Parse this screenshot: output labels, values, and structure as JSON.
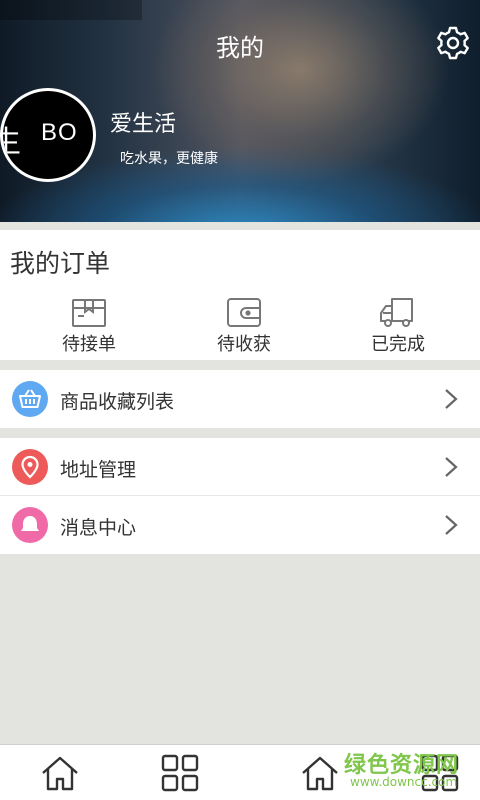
{
  "header": {
    "title": "我的",
    "settings_icon": "gear-icon",
    "user_name": "爱生活",
    "user_slogan": "吃水果，更健康",
    "avatar_text": "BO",
    "avatar_glyph": "生"
  },
  "orders": {
    "title": "我的订单",
    "items": [
      {
        "label": "待接单",
        "icon": "package-icon"
      },
      {
        "label": "待收获",
        "icon": "wallet-icon"
      },
      {
        "label": "已完成",
        "icon": "delivery-truck-icon"
      }
    ]
  },
  "menu": {
    "favorites": {
      "label": "商品收藏列表",
      "icon": "basket-icon",
      "color": "#5fa8f2"
    },
    "address": {
      "label": "地址管理",
      "icon": "location-pin-icon",
      "color": "#ee5a5a"
    },
    "messages": {
      "label": "消息中心",
      "icon": "bell-icon",
      "color": "#f06aa8"
    }
  },
  "tabbar": {
    "tabs": [
      {
        "icon": "home-icon"
      },
      {
        "icon": "grid-icon"
      },
      {
        "icon": "home-icon"
      },
      {
        "icon": "grid-icon"
      }
    ],
    "watermark": "绿色资源网",
    "watermark_sub": "www.downcc.com"
  }
}
